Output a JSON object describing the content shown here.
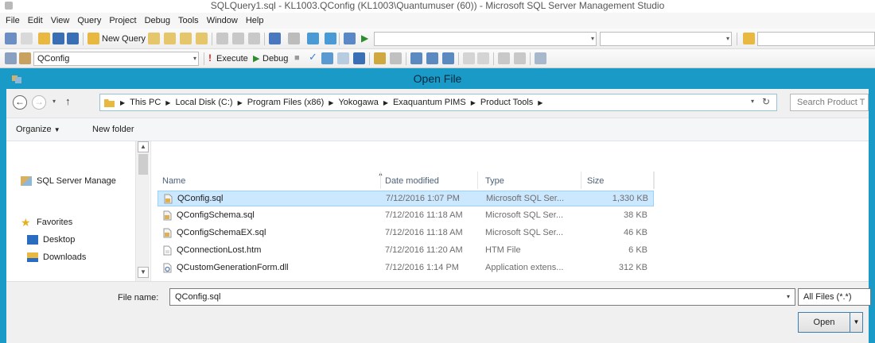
{
  "window": {
    "title": "SQLQuery1.sql - KL1003.QConfig (KL1003\\Quantumuser (60)) - Microsoft SQL Server Management Studio"
  },
  "menu": [
    "File",
    "Edit",
    "View",
    "Query",
    "Project",
    "Debug",
    "Tools",
    "Window",
    "Help"
  ],
  "toolbar1": {
    "new_query_label": "New Query"
  },
  "toolbar2": {
    "database_value": "QConfig",
    "execute_label": "Execute",
    "debug_label": "Debug"
  },
  "dialog": {
    "title": "Open File",
    "breadcrumb": [
      "This PC",
      "Local Disk (C:)",
      "Program Files (x86)",
      "Yokogawa",
      "Exaquantum PIMS",
      "Product Tools"
    ],
    "search_placeholder": "Search Product T",
    "organize_label": "Organize",
    "new_folder_label": "New folder",
    "nav_items": [
      {
        "label": "SQL Server Manage",
        "icon": "ssms-icon"
      },
      {
        "label": "Favorites",
        "icon": "star-icon"
      },
      {
        "label": "Desktop",
        "icon": "desktop-icon"
      },
      {
        "label": "Downloads",
        "icon": "downloads-icon"
      }
    ],
    "columns": {
      "name": "Name",
      "date": "Date modified",
      "type": "Type",
      "size": "Size"
    },
    "files": [
      {
        "name": "QConfig.sql",
        "date": "7/12/2016 1:07 PM",
        "type": "Microsoft SQL Ser...",
        "size": "1,330 KB",
        "selected": true,
        "icon": "sql-file-icon"
      },
      {
        "name": "QConfigSchema.sql",
        "date": "7/12/2016 11:18 AM",
        "type": "Microsoft SQL Ser...",
        "size": "38 KB",
        "selected": false,
        "icon": "sql-file-icon"
      },
      {
        "name": "QConfigSchemaEX.sql",
        "date": "7/12/2016 11:18 AM",
        "type": "Microsoft SQL Ser...",
        "size": "46 KB",
        "selected": false,
        "icon": "sql-file-icon"
      },
      {
        "name": "QConnectionLost.htm",
        "date": "7/12/2016 11:20 AM",
        "type": "HTM File",
        "size": "6 KB",
        "selected": false,
        "icon": "htm-file-icon"
      },
      {
        "name": "QCustomGenerationForm.dll",
        "date": "7/12/2016 1:14 PM",
        "type": "Application extens...",
        "size": "312 KB",
        "selected": false,
        "icon": "dll-file-icon"
      }
    ],
    "file_name_label": "File name:",
    "file_name_value": "QConfig.sql",
    "filter_value": "All Files (*.*)",
    "open_label": "Open"
  },
  "colors": {
    "dialog_frame": "#1a9ac6",
    "selection": "#cce8ff",
    "folder": "#e8b840"
  }
}
